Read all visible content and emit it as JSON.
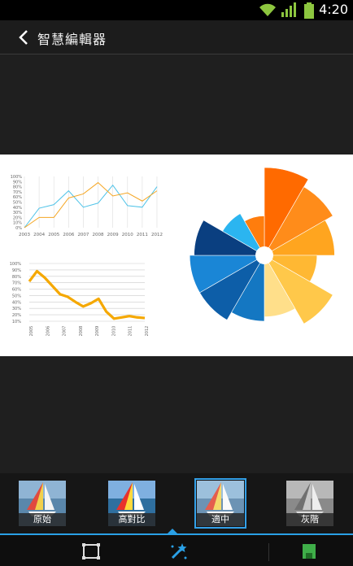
{
  "status": {
    "time": "4:20"
  },
  "header": {
    "title": "智慧編輯器"
  },
  "chart_data": [
    {
      "type": "line",
      "x": [
        "2003",
        "2004",
        "2005",
        "2006",
        "2007",
        "2008",
        "2009",
        "2010",
        "2011",
        "2012"
      ],
      "yticks": [
        "0%",
        "10%",
        "20%",
        "30%",
        "40%",
        "50%",
        "60%",
        "70%",
        "80%",
        "90%",
        "100%"
      ],
      "ylim": [
        0,
        100
      ],
      "series": [
        {
          "values": [
            0,
            38,
            45,
            72,
            40,
            48,
            83,
            43,
            40,
            80
          ],
          "color": "#4fc3e8"
        },
        {
          "values": [
            0,
            20,
            20,
            58,
            66,
            88,
            62,
            68,
            52,
            72
          ],
          "color": "#f5a623"
        }
      ]
    },
    {
      "type": "line",
      "x": [
        "2005",
        "2006",
        "2007",
        "2008",
        "2009",
        "2010",
        "2011",
        "2012"
      ],
      "yticks": [
        "10%",
        "20%",
        "30%",
        "40%",
        "50%",
        "60%",
        "70%",
        "80%",
        "90%",
        "100%"
      ],
      "ylim": [
        10,
        100
      ],
      "series": [
        {
          "values": [
            72,
            88,
            78,
            65,
            52,
            48,
            40,
            33,
            38,
            45,
            25,
            14,
            16,
            18,
            16,
            15
          ],
          "color": "#f5a800"
        }
      ]
    },
    {
      "type": "pie",
      "variant": "polar-area",
      "segments": [
        {
          "value": 100,
          "color": "#ff6a00"
        },
        {
          "value": 90,
          "color": "#ff8c1a"
        },
        {
          "value": 80,
          "color": "#ffa51f"
        },
        {
          "value": 60,
          "color": "#ffb833"
        },
        {
          "value": 90,
          "color": "#ffc84a"
        },
        {
          "value": 70,
          "color": "#ffdf8a"
        },
        {
          "value": 75,
          "color": "#1477c2"
        },
        {
          "value": 85,
          "color": "#0d5ea8"
        },
        {
          "value": 85,
          "color": "#1a86d6"
        },
        {
          "value": 80,
          "color": "#0a3f80"
        },
        {
          "value": 55,
          "color": "#2bb5f0"
        },
        {
          "value": 45,
          "color": "#ff7d0d"
        }
      ]
    }
  ],
  "filters": [
    {
      "label": "原始",
      "selected": false
    },
    {
      "label": "高對比",
      "selected": false
    },
    {
      "label": "適中",
      "selected": true
    },
    {
      "label": "灰階",
      "selected": false
    }
  ],
  "toolbar": {
    "icons": [
      "crop-icon",
      "magic-wand-icon",
      "save-icon"
    ]
  }
}
